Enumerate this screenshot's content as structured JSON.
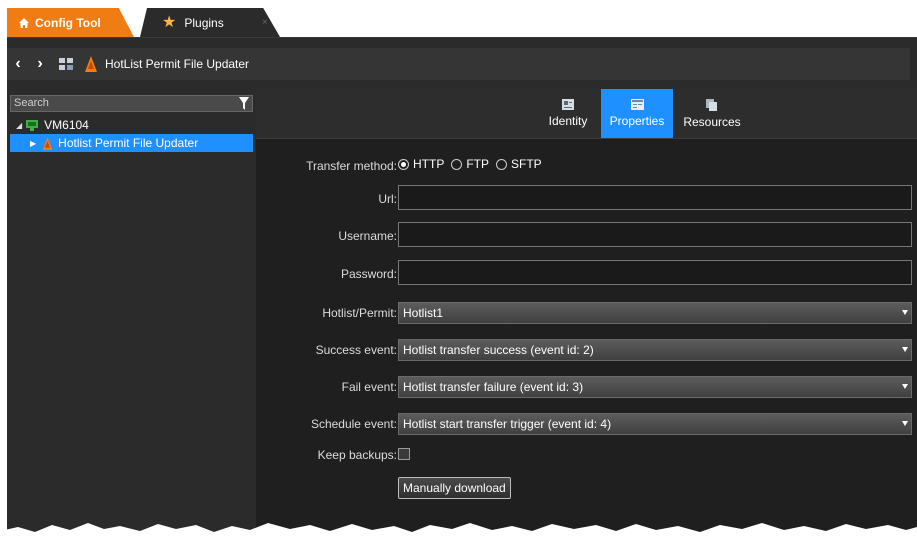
{
  "tabs": {
    "config_tool": "Config Tool",
    "plugins": "Plugins",
    "close_glyph": "×"
  },
  "address": {
    "back_glyph": "‹",
    "forward_glyph": "›",
    "title": "HotList Permit File Updater"
  },
  "sidebar": {
    "search_placeholder": "Search",
    "root_label": "VM6104",
    "child_label": "Hotlist Permit File Updater"
  },
  "view_tabs": {
    "identity": "Identity",
    "properties": "Properties",
    "resources": "Resources"
  },
  "form": {
    "transfer_method_label": "Transfer method:",
    "transfer_options": [
      "HTTP",
      "FTP",
      "SFTP"
    ],
    "transfer_selected": "HTTP",
    "url_label": "Url:",
    "url_value": "",
    "username_label": "Username:",
    "username_value": "",
    "password_label": "Password:",
    "password_value": "",
    "hotlist_label": "Hotlist/Permit:",
    "hotlist_value": "Hotlist1",
    "success_label": "Success event:",
    "success_value": "Hotlist transfer success (event id: 2)",
    "fail_label": "Fail event:",
    "fail_value": "Hotlist transfer failure (event id: 3)",
    "schedule_label": "Schedule event:",
    "schedule_value": "Hotlist start transfer trigger (event id: 4)",
    "keep_backups_label": "Keep backups:",
    "keep_backups_checked": false,
    "download_button": "Manually download"
  },
  "colors": {
    "accent_orange": "#f07c14",
    "selection_blue": "#1e90ff",
    "panel_dark": "#2b2b2b",
    "content_dark": "#1f1f1f"
  },
  "icons": [
    "home-icon",
    "star-icon",
    "back-icon",
    "forward-icon",
    "tile-icon",
    "plugin-icon",
    "filter-icon",
    "server-icon",
    "identity-icon",
    "properties-icon",
    "resources-icon",
    "chevron-down-icon"
  ]
}
